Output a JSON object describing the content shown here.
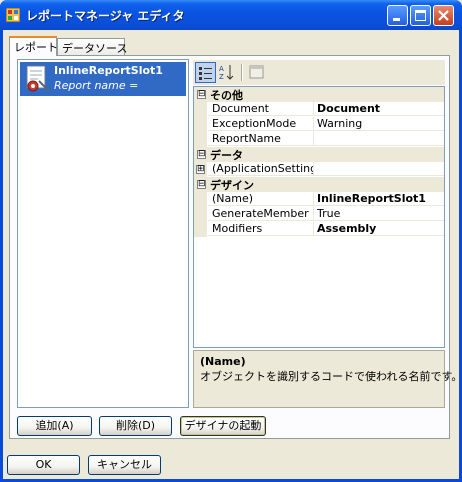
{
  "window": {
    "title": "レポートマネージャ エディタ"
  },
  "tabs": [
    {
      "label": "レポート"
    },
    {
      "label": "データソース"
    }
  ],
  "reports": [
    {
      "name": "InlineReportSlot1",
      "subtitle": "Report name ="
    }
  ],
  "property_grid": {
    "categories": [
      {
        "label": "その他",
        "expander": "⊟"
      },
      {
        "label": "データ",
        "expander": "⊟"
      },
      {
        "label": "デザイン",
        "expander": "⊟"
      }
    ],
    "rows": [
      {
        "name": "Document",
        "value": "Document"
      },
      {
        "name": "ExceptionMode",
        "value": "Warning"
      },
      {
        "name": "ReportName",
        "value": ""
      },
      {
        "name": "(ApplicationSettings)",
        "value": "",
        "expander": "⊞"
      },
      {
        "name": "(Name)",
        "value": "InlineReportSlot1"
      },
      {
        "name": "GenerateMember",
        "value": "True"
      },
      {
        "name": "Modifiers",
        "value": "Assembly"
      }
    ],
    "description": {
      "title": "(Name)",
      "text": "オブジェクトを識別するコードで使われる名前です。"
    }
  },
  "buttons": {
    "add": "追加(A)",
    "remove": "削除(D)",
    "launch_designer": "デザイナの起動",
    "ok": "OK",
    "cancel": "キャンセル"
  }
}
